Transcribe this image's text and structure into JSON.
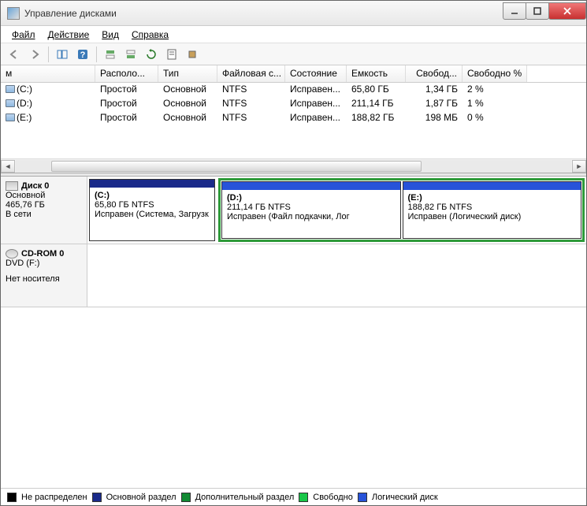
{
  "title": "Управление дисками",
  "menu": {
    "file": "Файл",
    "action": "Действие",
    "view": "Вид",
    "help": "Справка"
  },
  "columns": {
    "vol": "м",
    "layout": "Располо...",
    "type": "Тип",
    "fs": "Файловая с...",
    "status": "Состояние",
    "cap": "Емкость",
    "free": "Свобод...",
    "pct": "Свободно %"
  },
  "volumes": [
    {
      "name": "(C:)",
      "layout": "Простой",
      "type": "Основной",
      "fs": "NTFS",
      "status": "Исправен...",
      "cap": "65,80 ГБ",
      "free": "1,34 ГБ",
      "pct": "2 %"
    },
    {
      "name": "(D:)",
      "layout": "Простой",
      "type": "Основной",
      "fs": "NTFS",
      "status": "Исправен...",
      "cap": "211,14 ГБ",
      "free": "1,87 ГБ",
      "pct": "1 %"
    },
    {
      "name": "(E:)",
      "layout": "Простой",
      "type": "Основной",
      "fs": "NTFS",
      "status": "Исправен...",
      "cap": "188,82 ГБ",
      "free": "198 МБ",
      "pct": "0 %"
    }
  ],
  "disk0": {
    "title": "Диск 0",
    "type": "Основной",
    "size": "465,76 ГБ",
    "state": "В сети",
    "c": {
      "label": "(C:)",
      "line2": "65,80 ГБ NTFS",
      "line3": "Исправен (Система, Загрузк"
    },
    "d": {
      "label": "(D:)",
      "line2": "211,14 ГБ NTFS",
      "line3": "Исправен (Файл подкачки, Лог"
    },
    "e": {
      "label": "(E:)",
      "line2": "188,82 ГБ NTFS",
      "line3": "Исправен (Логический диск)"
    }
  },
  "cdrom": {
    "title": "CD-ROM 0",
    "type": "DVD (F:)",
    "state": "Нет носителя"
  },
  "legend": {
    "unalloc": "Не распределен",
    "primary": "Основной раздел",
    "extended": "Дополнительный раздел",
    "free": "Свободно",
    "logical": "Логический диск"
  }
}
